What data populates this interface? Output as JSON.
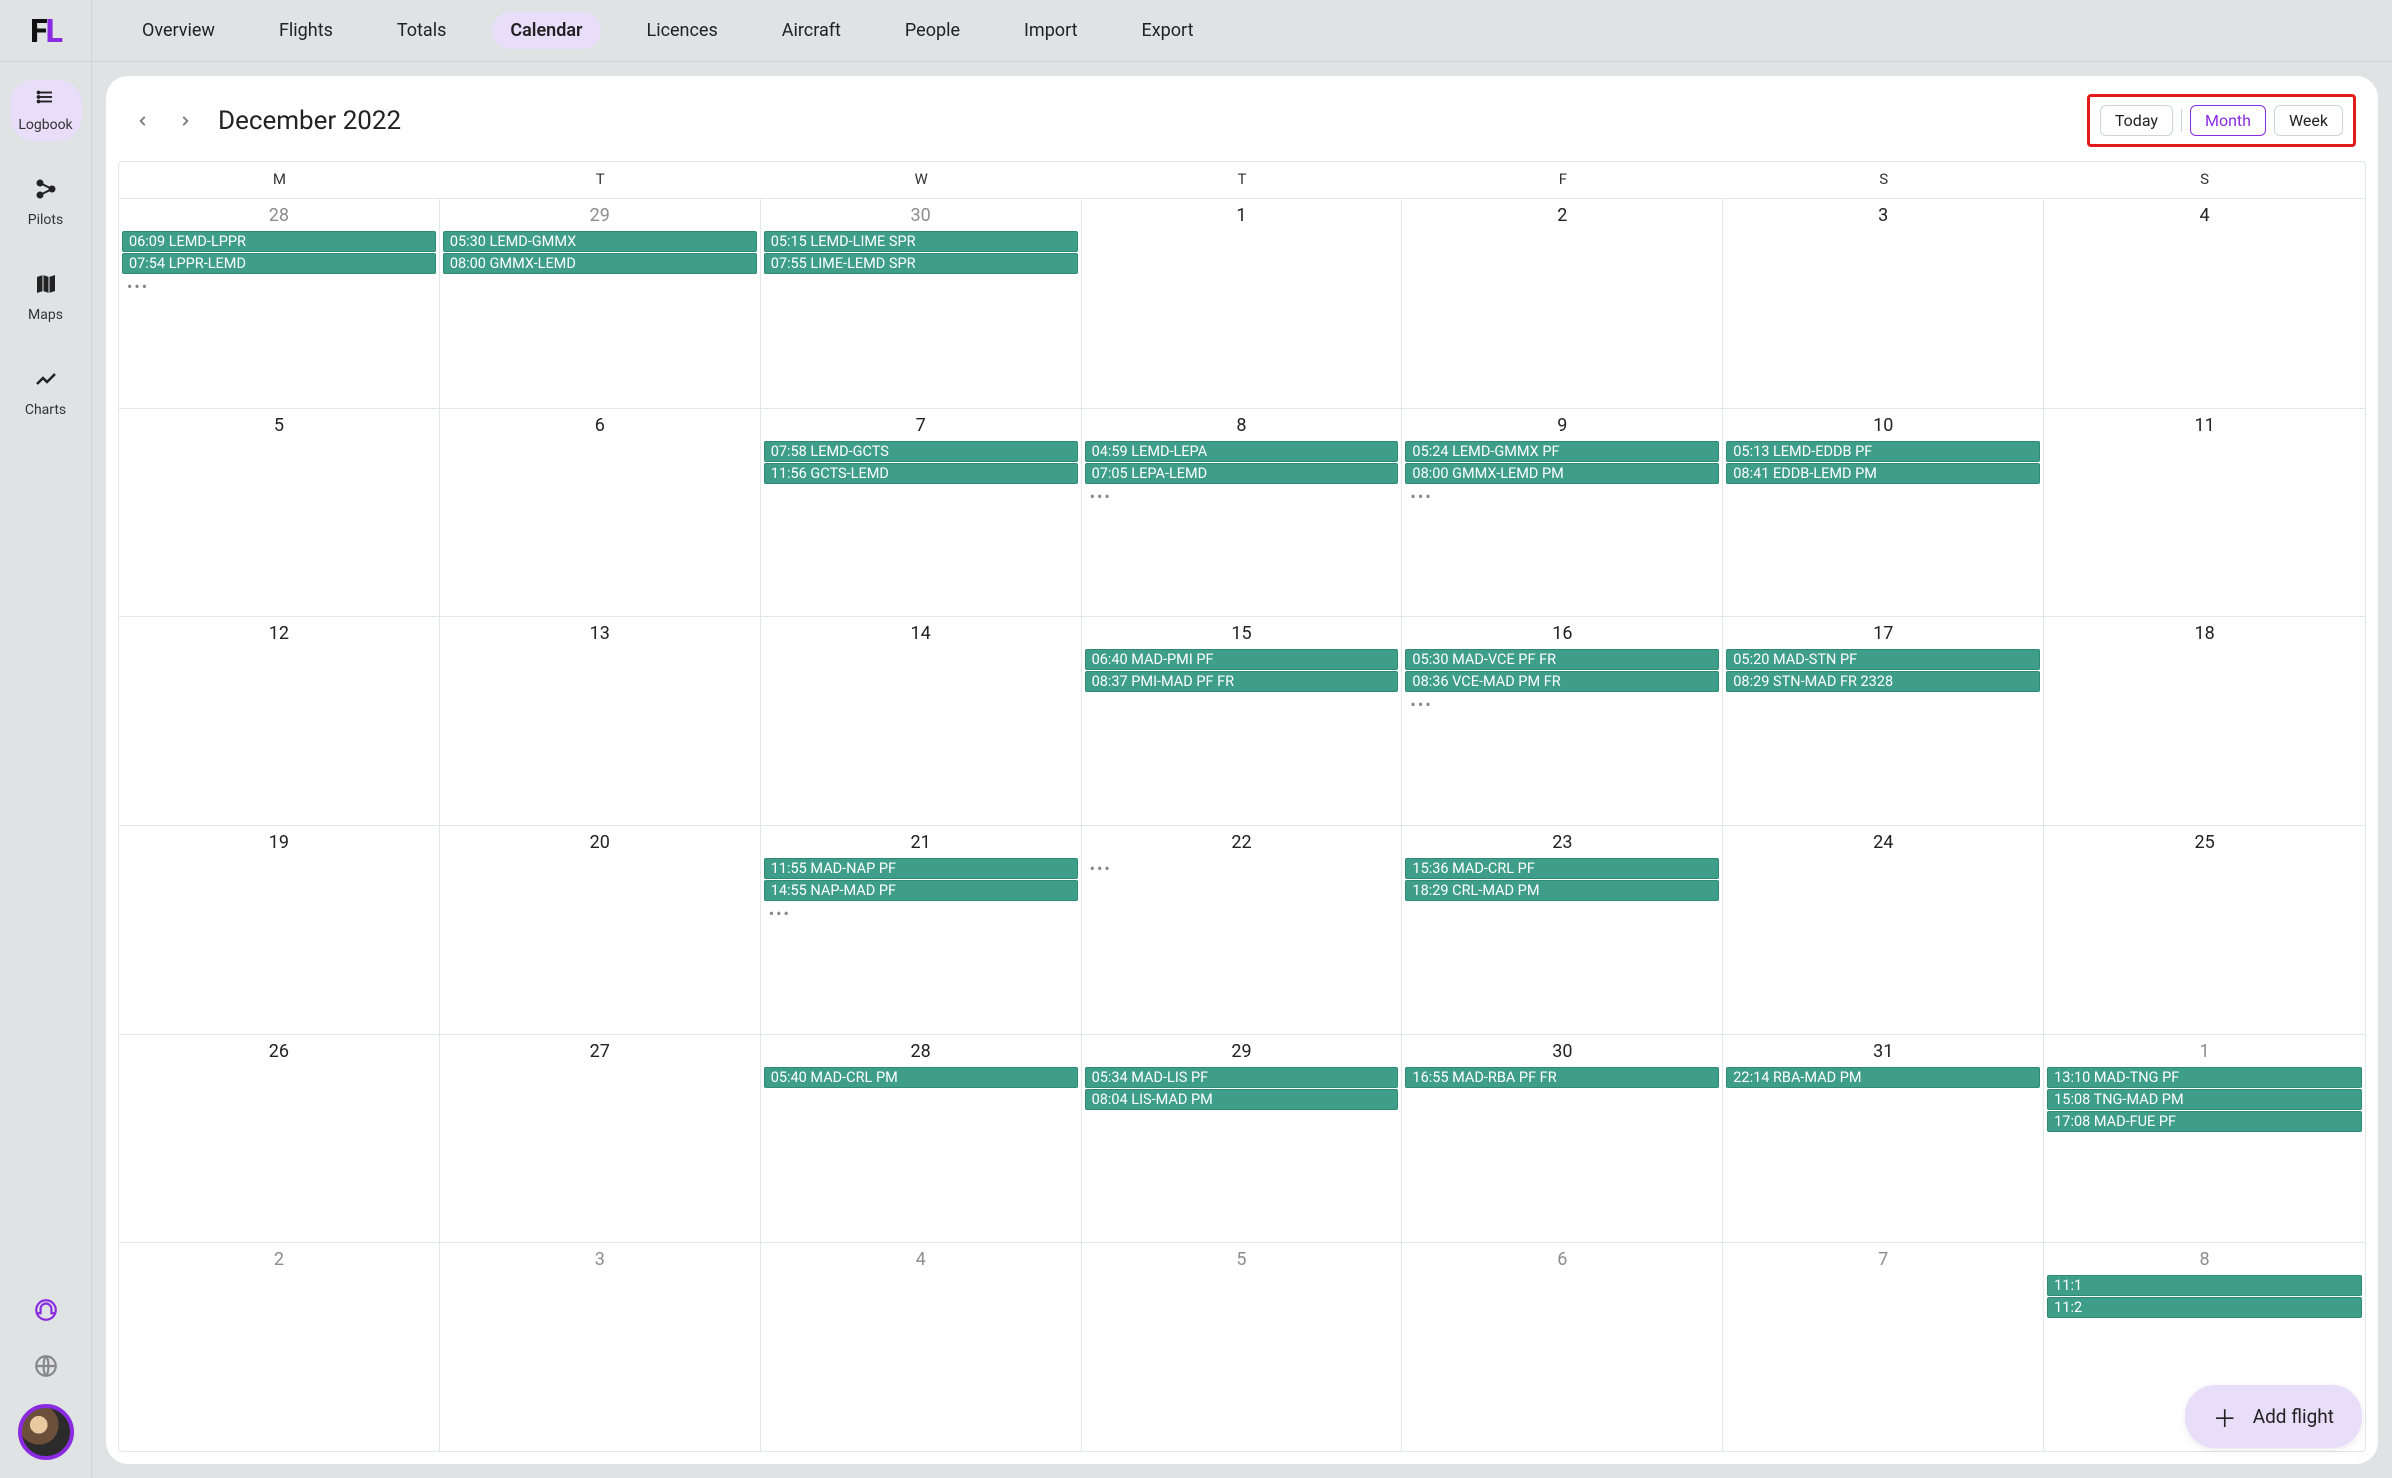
{
  "logo": {
    "f": "F",
    "l": "L"
  },
  "nav": {
    "items": [
      {
        "label": "Overview",
        "active": false
      },
      {
        "label": "Flights",
        "active": false
      },
      {
        "label": "Totals",
        "active": false
      },
      {
        "label": "Calendar",
        "active": true
      },
      {
        "label": "Licences",
        "active": false
      },
      {
        "label": "Aircraft",
        "active": false
      },
      {
        "label": "People",
        "active": false
      },
      {
        "label": "Import",
        "active": false
      },
      {
        "label": "Export",
        "active": false
      }
    ]
  },
  "sidebar": {
    "items": [
      {
        "icon": "☰",
        "label": "Logbook",
        "active": true
      },
      {
        "icon": "⚬",
        "label": "Pilots",
        "active": false
      },
      {
        "icon": "▯",
        "label": "Maps",
        "active": false
      },
      {
        "icon": "〜",
        "label": "Charts",
        "active": false
      }
    ]
  },
  "calendar": {
    "title": "December 2022",
    "view_buttons": {
      "today": "Today",
      "month": "Month",
      "week": "Week"
    },
    "dow": [
      "M",
      "T",
      "W",
      "T",
      "F",
      "S",
      "S"
    ],
    "weeks": [
      [
        {
          "num": "28",
          "muted": true,
          "events": [
            "06:09 LEMD-LPPR",
            "07:54 LPPR-LEMD"
          ],
          "more": true
        },
        {
          "num": "29",
          "muted": true,
          "events": [
            "05:30 LEMD-GMMX",
            "08:00 GMMX-LEMD"
          ]
        },
        {
          "num": "30",
          "muted": true,
          "events": [
            "05:15 LEMD-LIME SPR",
            "07:55 LIME-LEMD SPR"
          ]
        },
        {
          "num": "1",
          "events": []
        },
        {
          "num": "2",
          "events": []
        },
        {
          "num": "3",
          "events": []
        },
        {
          "num": "4",
          "events": []
        }
      ],
      [
        {
          "num": "5",
          "events": []
        },
        {
          "num": "6",
          "events": []
        },
        {
          "num": "7",
          "events": [
            "07:58 LEMD-GCTS",
            "11:56 GCTS-LEMD"
          ]
        },
        {
          "num": "8",
          "events": [
            "04:59 LEMD-LEPA",
            "07:05 LEPA-LEMD"
          ],
          "more": true
        },
        {
          "num": "9",
          "events": [
            "05:24 LEMD-GMMX PF",
            "08:00 GMMX-LEMD PM"
          ],
          "more": true
        },
        {
          "num": "10",
          "events": [
            "05:13 LEMD-EDDB PF",
            "08:41 EDDB-LEMD PM"
          ]
        },
        {
          "num": "11",
          "events": []
        }
      ],
      [
        {
          "num": "12",
          "events": []
        },
        {
          "num": "13",
          "events": []
        },
        {
          "num": "14",
          "events": []
        },
        {
          "num": "15",
          "events": [
            "06:40 MAD-PMI PF",
            "08:37 PMI-MAD PF FR"
          ]
        },
        {
          "num": "16",
          "events": [
            "05:30 MAD-VCE PF FR",
            "08:36 VCE-MAD PM FR"
          ],
          "more": true
        },
        {
          "num": "17",
          "events": [
            "05:20 MAD-STN PF",
            "08:29 STN-MAD FR 2328"
          ]
        },
        {
          "num": "18",
          "events": []
        }
      ],
      [
        {
          "num": "19",
          "events": []
        },
        {
          "num": "20",
          "events": []
        },
        {
          "num": "21",
          "events": [
            "11:55 MAD-NAP PF",
            "14:55 NAP-MAD PF"
          ],
          "more": true
        },
        {
          "num": "22",
          "events": [],
          "more": true
        },
        {
          "num": "23",
          "events": [
            "15:36 MAD-CRL PF",
            "18:29 CRL-MAD PM"
          ]
        },
        {
          "num": "24",
          "events": []
        },
        {
          "num": "25",
          "events": []
        }
      ],
      [
        {
          "num": "26",
          "events": []
        },
        {
          "num": "27",
          "events": []
        },
        {
          "num": "28",
          "events": [
            "05:40 MAD-CRL PM"
          ]
        },
        {
          "num": "29",
          "events": [
            "05:34 MAD-LIS PF",
            "08:04 LIS-MAD PM"
          ]
        },
        {
          "num": "30",
          "events": [
            "16:55 MAD-RBA PF FR"
          ]
        },
        {
          "num": "31",
          "events": [
            "22:14 RBA-MAD PM"
          ]
        },
        {
          "num": "1",
          "muted": true,
          "events": [
            "13:10 MAD-TNG PF",
            "15:08 TNG-MAD PM",
            "17:08 MAD-FUE PF"
          ]
        }
      ],
      [
        {
          "num": "2",
          "muted": true,
          "events": []
        },
        {
          "num": "3",
          "muted": true,
          "events": []
        },
        {
          "num": "4",
          "muted": true,
          "events": []
        },
        {
          "num": "5",
          "muted": true,
          "events": []
        },
        {
          "num": "6",
          "muted": true,
          "events": []
        },
        {
          "num": "7",
          "muted": true,
          "events": []
        },
        {
          "num": "8",
          "muted": true,
          "events": [
            "11:1",
            "11:2"
          ]
        }
      ]
    ]
  },
  "add_flight": {
    "label": "Add flight"
  }
}
